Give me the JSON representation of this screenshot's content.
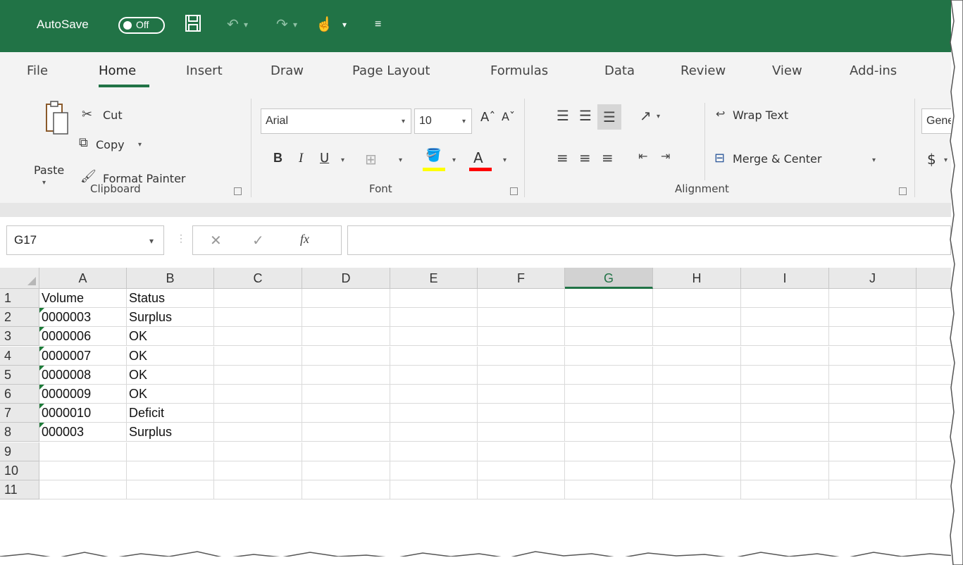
{
  "titlebar": {
    "autosave_label": "AutoSave",
    "autosave_state": "Off",
    "accent": "#217346"
  },
  "tabs": [
    "File",
    "Home",
    "Insert",
    "Draw",
    "Page Layout",
    "Formulas",
    "Data",
    "Review",
    "View",
    "Add-ins"
  ],
  "clipboard": {
    "paste": "Paste",
    "cut": "Cut",
    "copy": "Copy",
    "format_painter": "Format Painter",
    "group": "Clipboard"
  },
  "font": {
    "name": "Arial",
    "size": "10",
    "bold": "B",
    "italic": "I",
    "underline": "U",
    "group": "Font",
    "grow": "Aˆ",
    "shrink": "Aˇ",
    "fill_color": "#ffff00",
    "font_color": "#ff0000"
  },
  "alignment": {
    "wrap": "Wrap Text",
    "merge": "Merge & Center",
    "group": "Alignment"
  },
  "number": {
    "format": "Gener",
    "currency": "$"
  },
  "formula_bar": {
    "name_box": "G17",
    "fx": "fx",
    "value": ""
  },
  "grid": {
    "columns": [
      "A",
      "B",
      "C",
      "D",
      "E",
      "F",
      "G",
      "H",
      "I",
      "J"
    ],
    "selected_column": "G",
    "rows": [
      {
        "n": "1",
        "cells": [
          "Volume",
          "Status"
        ]
      },
      {
        "n": "2",
        "cells": [
          "0000003",
          "Surplus"
        ]
      },
      {
        "n": "3",
        "cells": [
          "0000006",
          "OK"
        ]
      },
      {
        "n": "4",
        "cells": [
          "0000007",
          "OK"
        ]
      },
      {
        "n": "5",
        "cells": [
          "0000008",
          "OK"
        ]
      },
      {
        "n": "6",
        "cells": [
          "0000009",
          "OK"
        ]
      },
      {
        "n": "7",
        "cells": [
          "0000010",
          "Deficit"
        ]
      },
      {
        "n": "8",
        "cells": [
          "000003",
          "Surplus"
        ]
      },
      {
        "n": "9",
        "cells": [
          "",
          ""
        ]
      },
      {
        "n": "10",
        "cells": [
          "",
          ""
        ]
      },
      {
        "n": "11",
        "cells": [
          "",
          ""
        ]
      }
    ]
  }
}
